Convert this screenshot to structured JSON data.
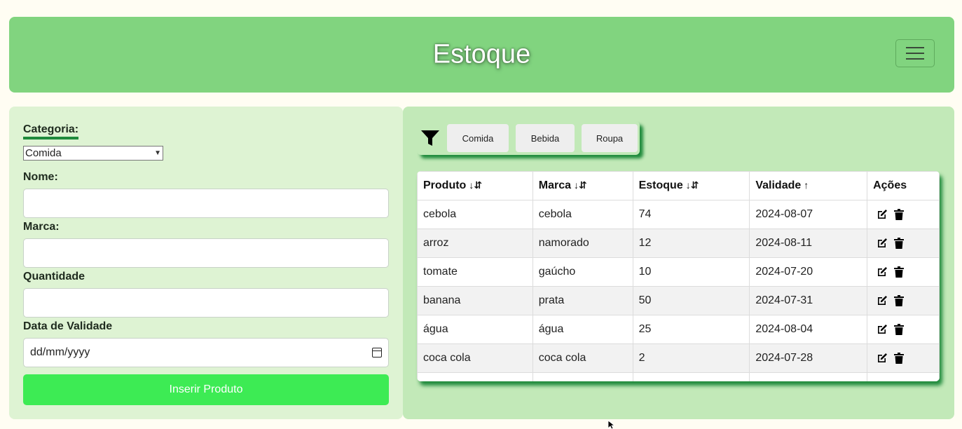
{
  "header": {
    "title": "Estoque"
  },
  "form": {
    "category_label": "Categoria:",
    "category_value": "Comida",
    "name_label": "Nome:",
    "name_value": "",
    "brand_label": "Marca:",
    "brand_value": "",
    "quantity_label": "Quantidade",
    "quantity_value": "",
    "expiry_label": "Data de Validade",
    "expiry_placeholder": "dd/mm/yyyy",
    "submit_label": "Inserir Produto"
  },
  "filters": {
    "icon": "filter-icon",
    "buttons": [
      "Comida",
      "Bebida",
      "Roupa"
    ]
  },
  "table": {
    "columns": [
      {
        "label": "Produto",
        "sort_icon": "↓⇵"
      },
      {
        "label": "Marca",
        "sort_icon": "↓⇵"
      },
      {
        "label": "Estoque",
        "sort_icon": "↓⇵"
      },
      {
        "label": "Validade",
        "sort_icon": "↑"
      },
      {
        "label": "Ações"
      }
    ],
    "rows": [
      {
        "produto": "cebola",
        "marca": "cebola",
        "estoque": "74",
        "validade": "2024-08-07"
      },
      {
        "produto": "arroz",
        "marca": "namorado",
        "estoque": "12",
        "validade": "2024-08-11"
      },
      {
        "produto": "tomate",
        "marca": "gaúcho",
        "estoque": "10",
        "validade": "2024-07-20"
      },
      {
        "produto": "banana",
        "marca": "prata",
        "estoque": "50",
        "validade": "2024-07-31"
      },
      {
        "produto": "água",
        "marca": "água",
        "estoque": "25",
        "validade": "2024-08-04"
      },
      {
        "produto": "coca cola",
        "marca": "coca cola",
        "estoque": "2",
        "validade": "2024-07-28"
      }
    ],
    "row_action_icons": [
      "edit-icon",
      "trash-icon"
    ]
  },
  "colors": {
    "header_bg": "#81d47f",
    "form_panel_bg": "#def3d3",
    "table_panel_bg": "#c2e9b8",
    "accent_dark": "#1f8a3c",
    "submit_bg": "#3deb54"
  }
}
